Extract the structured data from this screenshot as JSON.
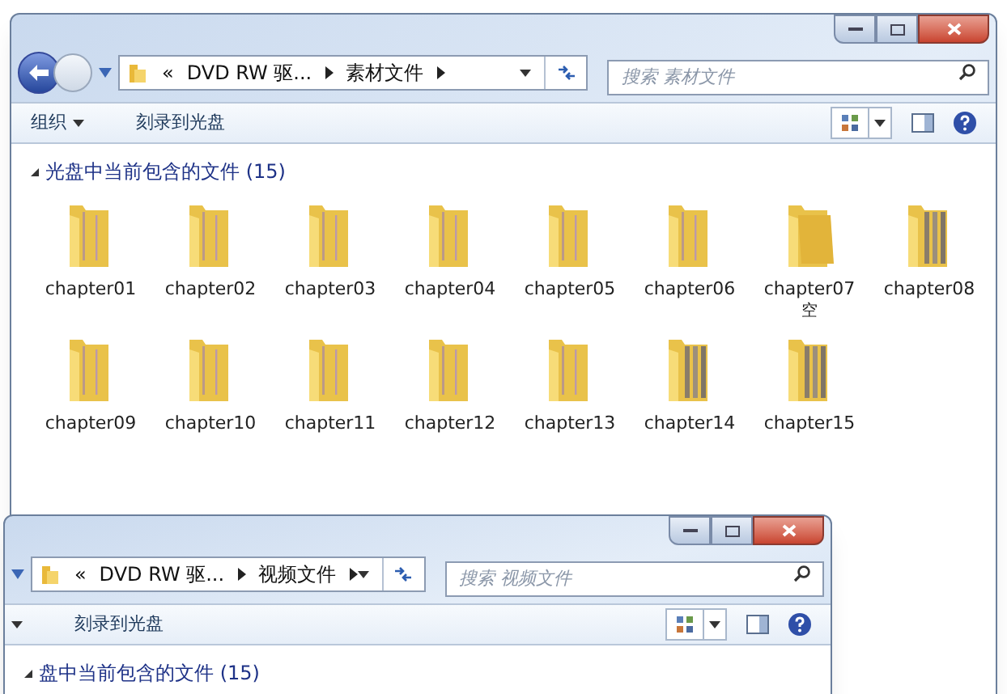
{
  "windows": [
    {
      "has_back": true,
      "address": {
        "prefix": "«",
        "segments": [
          "DVD RW 驱...",
          "素材文件"
        ]
      },
      "search": {
        "placeholder": "搜索 素材文件"
      },
      "toolbar": {
        "organize": "组织",
        "burn": "刻录到光盘"
      },
      "group": {
        "title": "光盘中当前包含的文件 (15)",
        "items": [
          {
            "name": "chapter01",
            "kind": "light"
          },
          {
            "name": "chapter02",
            "kind": "light"
          },
          {
            "name": "chapter03",
            "kind": "light"
          },
          {
            "name": "chapter04",
            "kind": "light"
          },
          {
            "name": "chapter05",
            "kind": "light"
          },
          {
            "name": "chapter06",
            "kind": "light"
          },
          {
            "name": "chapter07",
            "note": "空",
            "kind": "plain"
          },
          {
            "name": "chapter08",
            "kind": "stacked"
          },
          {
            "name": "chapter09",
            "kind": "light"
          },
          {
            "name": "chapter10",
            "kind": "light"
          },
          {
            "name": "chapter11",
            "kind": "light"
          },
          {
            "name": "chapter12",
            "kind": "light"
          },
          {
            "name": "chapter13",
            "kind": "light"
          },
          {
            "name": "chapter14",
            "kind": "stacked"
          },
          {
            "name": "chapter15",
            "kind": "stacked"
          }
        ]
      }
    },
    {
      "has_back": false,
      "address": {
        "prefix": "«",
        "segments": [
          "DVD RW 驱...",
          "视频文件"
        ]
      },
      "search": {
        "placeholder": "搜索 视频文件"
      },
      "toolbar": {
        "burn": "刻录到光盘"
      },
      "group": {
        "title": "盘中当前包含的文件 (15)"
      }
    }
  ]
}
